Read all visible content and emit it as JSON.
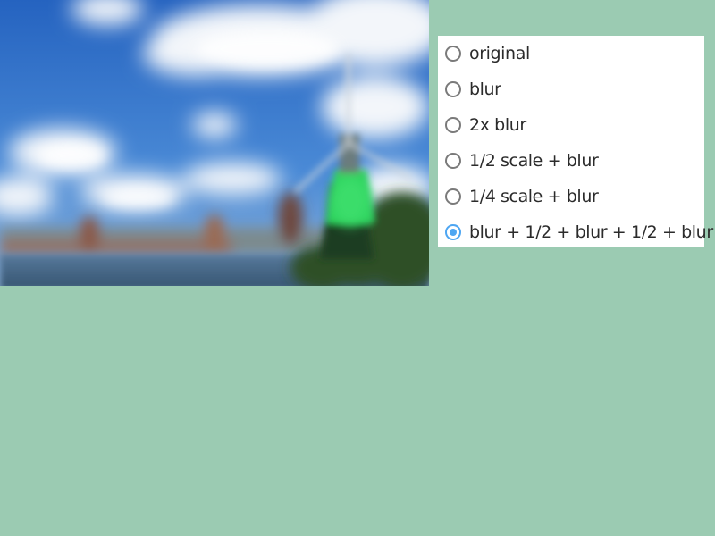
{
  "image": {
    "subject": "windmill-landscape",
    "colors": {
      "sky": "#2f6fc4",
      "cloud": "#f2f5f8",
      "water": "#3a6a8f",
      "windmill_green": "#2ad05a",
      "trees": "#2d4a22"
    }
  },
  "options": [
    {
      "label": "original",
      "checked": false
    },
    {
      "label": "blur",
      "checked": false
    },
    {
      "label": "2x blur",
      "checked": false
    },
    {
      "label": "1/2 scale + blur",
      "checked": false
    },
    {
      "label": "1/4 scale + blur",
      "checked": false
    },
    {
      "label": "blur + 1/2 + blur + 1/2 + blur",
      "checked": true
    }
  ],
  "colors": {
    "background": "#9bcbb2",
    "panel": "#ffffff",
    "radio_accent": "#4ea6f2",
    "radio_border": "#7a7a7a",
    "text": "#2b2b2b"
  }
}
